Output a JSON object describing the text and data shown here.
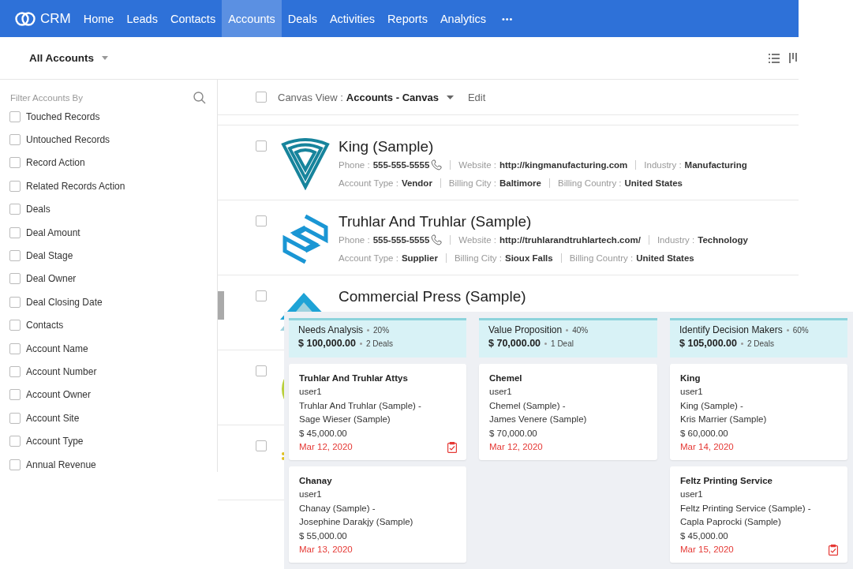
{
  "nav": {
    "logo": "CRM",
    "tabs": [
      {
        "label": "Home",
        "selected": false
      },
      {
        "label": "Leads",
        "selected": false
      },
      {
        "label": "Contacts",
        "selected": false
      },
      {
        "label": "Accounts",
        "selected": true
      },
      {
        "label": "Deals",
        "selected": false
      },
      {
        "label": "Activities",
        "selected": false
      },
      {
        "label": "Reports",
        "selected": false
      },
      {
        "label": "Analytics",
        "selected": false
      }
    ],
    "more": "•••"
  },
  "view": {
    "title": "All Accounts"
  },
  "filter": {
    "title": "Filter Accounts By",
    "items": [
      {
        "label": "Touched Records",
        "checked": false
      },
      {
        "label": "Untouched Records",
        "checked": false
      },
      {
        "label": "Record Action",
        "checked": false
      },
      {
        "label": "Related Records Action",
        "checked": false
      },
      {
        "label": "Deals",
        "checked": false
      },
      {
        "label": "Deal Amount",
        "checked": false
      },
      {
        "label": "Deal Stage",
        "checked": false
      },
      {
        "label": "Deal Owner",
        "checked": false
      },
      {
        "label": "Deal Closing Date",
        "checked": false
      },
      {
        "label": "Contacts",
        "checked": false
      },
      {
        "label": "Account Name",
        "checked": false
      },
      {
        "label": "Account Number",
        "checked": false
      },
      {
        "label": "Account Owner",
        "checked": false
      },
      {
        "label": "Account Site",
        "checked": false
      },
      {
        "label": "Account Type",
        "checked": false
      },
      {
        "label": "Annual Revenue",
        "checked": false
      }
    ]
  },
  "canvas": {
    "label": "Canvas View :",
    "view": "Accounts - Canvas",
    "edit": "Edit",
    "checked": false,
    "records": [
      {
        "name": "King (Sample)",
        "kind": "shield",
        "checked": false,
        "lines": [
          [
            {
              "label": "Phone :",
              "value": "555-555-5555",
              "call": true
            },
            {
              "label": "Website :",
              "value": "http://kingmanufacturing.com"
            },
            {
              "label": "Industry :",
              "value": "Manufacturing"
            }
          ],
          [
            {
              "label": "Account Type :",
              "value": "Vendor"
            },
            {
              "label": "Billing City :",
              "value": "Baltimore"
            },
            {
              "label": "Billing Country :",
              "value": "United States"
            }
          ]
        ]
      },
      {
        "name": "Truhlar And Truhlar (Sample)",
        "kind": "hex",
        "checked": false,
        "lines": [
          [
            {
              "label": "Phone :",
              "value": "555-555-5555",
              "call": true
            },
            {
              "label": "Website :",
              "value": "http://truhlarandtruhlartech.com/"
            },
            {
              "label": "Industry :",
              "value": "Technology"
            }
          ],
          [
            {
              "label": "Account Type :",
              "value": "Supplier"
            },
            {
              "label": "Billing City :",
              "value": "Sioux Falls"
            },
            {
              "label": "Billing Country :",
              "value": "United States"
            }
          ]
        ]
      },
      {
        "name": "Commercial Press (Sample)",
        "kind": "mountain",
        "checked": false
      },
      {
        "kind": "circle",
        "checked": false
      },
      {
        "kind": "dots",
        "checked": false
      }
    ]
  },
  "pipeline": {
    "stages": [
      {
        "name": "Needs Analysis",
        "percent": "20%",
        "amount": "$ 100,000.00",
        "count": "2 Deals",
        "deals": [
          {
            "title": "Truhlar And Truhlar Attys",
            "owner": "user1",
            "account": "Truhlar And Truhlar (Sample)  -",
            "contact": "Sage Wieser (Sample)",
            "amount": "$ 45,000.00",
            "date": "Mar 12, 2020",
            "task": true
          },
          {
            "title": "Chanay",
            "owner": "user1",
            "account": "Chanay (Sample)  -",
            "contact": "Josephine Darakjy (Sample)",
            "amount": "$ 55,000.00",
            "date": "Mar 13, 2020",
            "task": false
          }
        ]
      },
      {
        "name": "Value Proposition",
        "percent": "40%",
        "amount": "$ 70,000.00",
        "count": "1 Deal",
        "deals": [
          {
            "title": "Chemel",
            "owner": "user1",
            "account": "Chemel (Sample)  -",
            "contact": "James Venere (Sample)",
            "amount": "$ 70,000.00",
            "date": "Mar 12, 2020",
            "task": false
          }
        ]
      },
      {
        "name": "Identify Decision Makers",
        "percent": "60%",
        "amount": "$ 105,000.00",
        "count": "2 Deals",
        "deals": [
          {
            "title": "King",
            "owner": "user1",
            "account": "King (Sample)  -",
            "contact": "Kris Marrier (Sample)",
            "amount": "$ 60,000.00",
            "date": "Mar 14, 2020",
            "task": false
          },
          {
            "title": "Feltz Printing Service",
            "owner": "user1",
            "account": "Feltz Printing Service (Sample)  -",
            "contact": "Capla Paprocki (Sample)",
            "amount": "$ 45,000.00",
            "date": "Mar 15, 2020",
            "task": true
          }
        ]
      }
    ]
  }
}
